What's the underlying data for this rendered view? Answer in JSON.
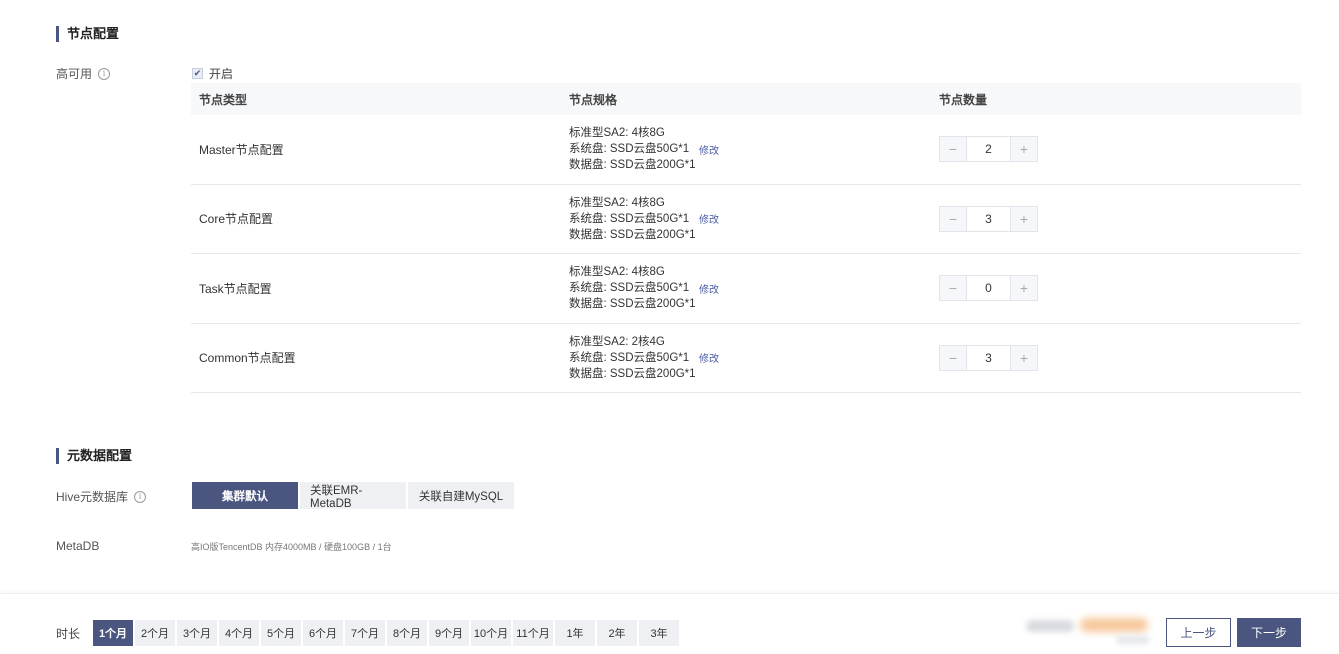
{
  "node_config": {
    "title": "节点配置",
    "ha_label": "高可用",
    "ha_toggle_label": "开启",
    "ha_checked": true,
    "columns": [
      "节点类型",
      "节点规格",
      "节点数量"
    ],
    "edit_label": "修改",
    "rows": [
      {
        "type": "Master节点配置",
        "spec": [
          "标准型SA2: 4核8G",
          "系统盘: SSD云盘50G*1",
          "数据盘: SSD云盘200G*1"
        ],
        "count": "2"
      },
      {
        "type": "Core节点配置",
        "spec": [
          "标准型SA2: 4核8G",
          "系统盘: SSD云盘50G*1",
          "数据盘: SSD云盘200G*1"
        ],
        "count": "3"
      },
      {
        "type": "Task节点配置",
        "spec": [
          "标准型SA2: 4核8G",
          "系统盘: SSD云盘50G*1",
          "数据盘: SSD云盘200G*1"
        ],
        "count": "0"
      },
      {
        "type": "Common节点配置",
        "spec": [
          "标准型SA2: 2核4G",
          "系统盘: SSD云盘50G*1",
          "数据盘: SSD云盘200G*1"
        ],
        "count": "3"
      }
    ]
  },
  "metadata_config": {
    "title": "元数据配置",
    "hive_label": "Hive元数据库",
    "options": [
      "集群默认",
      "关联EMR-MetaDB",
      "关联自建MySQL"
    ],
    "selected": "集群默认",
    "metadb_label": "MetaDB",
    "metadb_info": "高IO版TencentDB 内存4000MB / 硬盘100GB / 1台"
  },
  "footer": {
    "duration_label": "时长",
    "durations": [
      "1个月",
      "2个月",
      "3个月",
      "4个月",
      "5个月",
      "6个月",
      "7个月",
      "8个月",
      "9个月",
      "10个月",
      "11个月",
      "1年",
      "2年",
      "3年"
    ],
    "selected_duration": "1个月",
    "prev_label": "上一步",
    "next_label": "下一步"
  },
  "colors": {
    "accent": "#4a5680",
    "link": "#4a5ba8"
  }
}
